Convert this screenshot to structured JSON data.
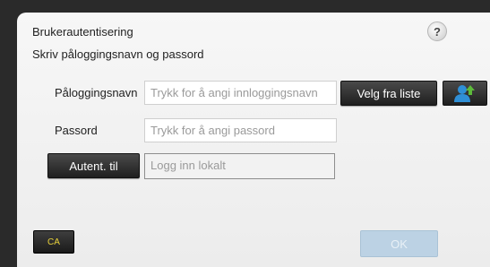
{
  "header": {
    "title": "Brukerautentisering",
    "subtitle": "Skriv påloggingsnavn og passord",
    "help_label": "?"
  },
  "form": {
    "login_label": "Påloggingsnavn",
    "login_placeholder": "Trykk for å angi innloggingsnavn",
    "select_from_list_label": "Velg fra liste",
    "user_list_icon": "user-list-icon",
    "password_label": "Passord",
    "password_placeholder": "Trykk for å angi passord",
    "auth_to_label": "Autent. til",
    "auth_to_value": "Logg inn lokalt"
  },
  "footer": {
    "ca_label": "CA",
    "ok_label": "OK"
  },
  "colors": {
    "accent_ca_text": "#e8d13a",
    "ok_disabled_bg": "#bcd2e4",
    "user_icon_blue": "#2f8fd6",
    "user_icon_green": "#5dbb3a"
  }
}
